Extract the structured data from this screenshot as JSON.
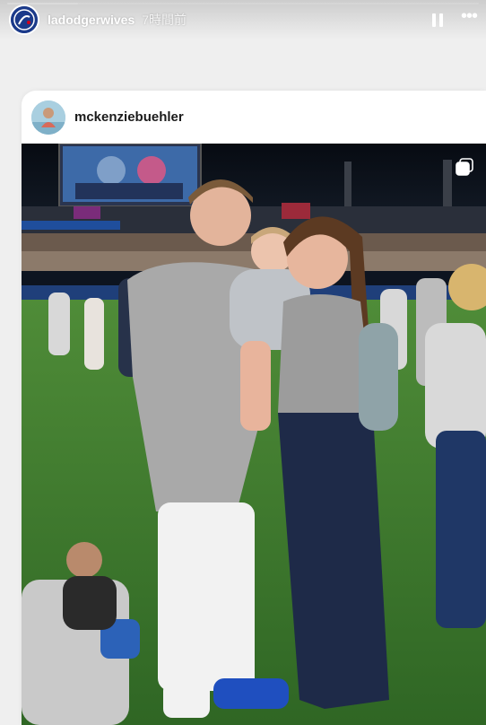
{
  "story": {
    "username": "ladodgerwives",
    "timestamp": "7時間前",
    "progress": 0.15
  },
  "controls": {
    "pause_icon": "pause-icon",
    "more_icon": "more-options-icon"
  },
  "post": {
    "username": "mckenziebuehler",
    "photo_icon": "multiple-photos-icon"
  },
  "colors": {
    "dodger_blue": "#1b3a8a",
    "grass": "#3d7a2b",
    "sky": "#0d1420"
  }
}
